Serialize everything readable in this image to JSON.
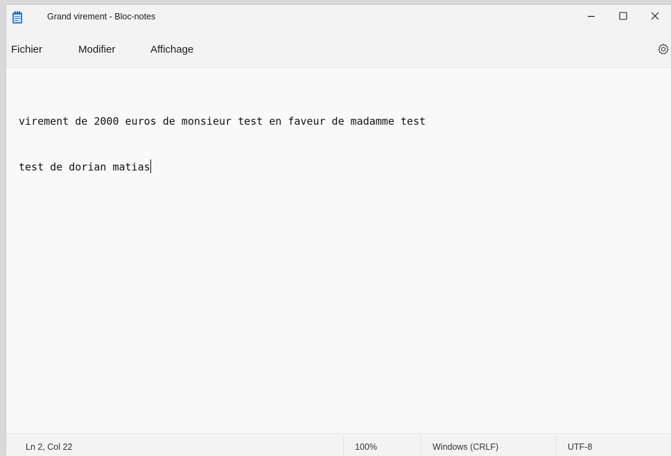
{
  "titlebar": {
    "title": "Grand virement - Bloc-notes",
    "app_icon": "notepad-icon",
    "buttons": {
      "minimize_icon": "minimize-icon",
      "maximize_icon": "maximize-icon",
      "close_icon": "close-icon"
    }
  },
  "menubar": {
    "items": [
      "Fichier",
      "Modifier",
      "Affichage"
    ],
    "settings_icon": "gear-icon"
  },
  "editor": {
    "lines": [
      "virement de 2000 euros de monsieur test en faveur de madamme test",
      "test de dorian matias"
    ]
  },
  "statusbar": {
    "position": "Ln 2, Col 22",
    "zoom": "100%",
    "line_ending": "Windows (CRLF)",
    "encoding": "UTF-8"
  },
  "colors": {
    "window_bg": "#f3f3f3",
    "editor_bg": "#f9f9f9",
    "icon_accent": "#2f7bd3"
  }
}
